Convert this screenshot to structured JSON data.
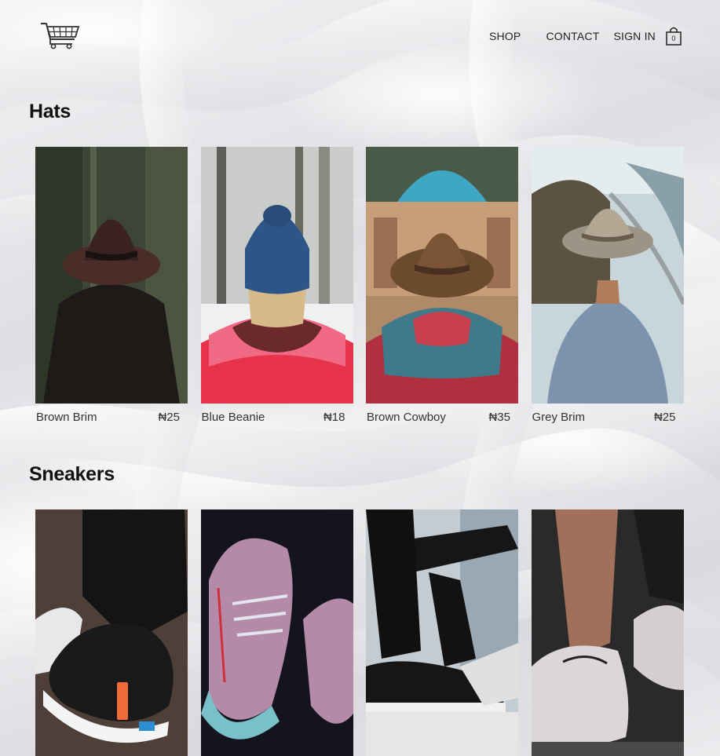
{
  "header": {
    "logo_icon": "shopping-cart-icon",
    "nav": {
      "shop": "SHOP",
      "contact": "CONTACT",
      "sign_in": "SIGN IN"
    },
    "bag_icon": "shopping-bag-icon",
    "bag_count": "0"
  },
  "sections": [
    {
      "title": "Hats",
      "items": [
        {
          "name": "Brown Brim",
          "price": "₦25"
        },
        {
          "name": "Blue Beanie",
          "price": "₦18"
        },
        {
          "name": "Brown Cowboy",
          "price": "₦35"
        },
        {
          "name": "Grey Brim",
          "price": "₦25"
        }
      ]
    },
    {
      "title": "Sneakers",
      "items": []
    }
  ],
  "colors": {
    "text": "#222222",
    "background": "#ececef"
  }
}
